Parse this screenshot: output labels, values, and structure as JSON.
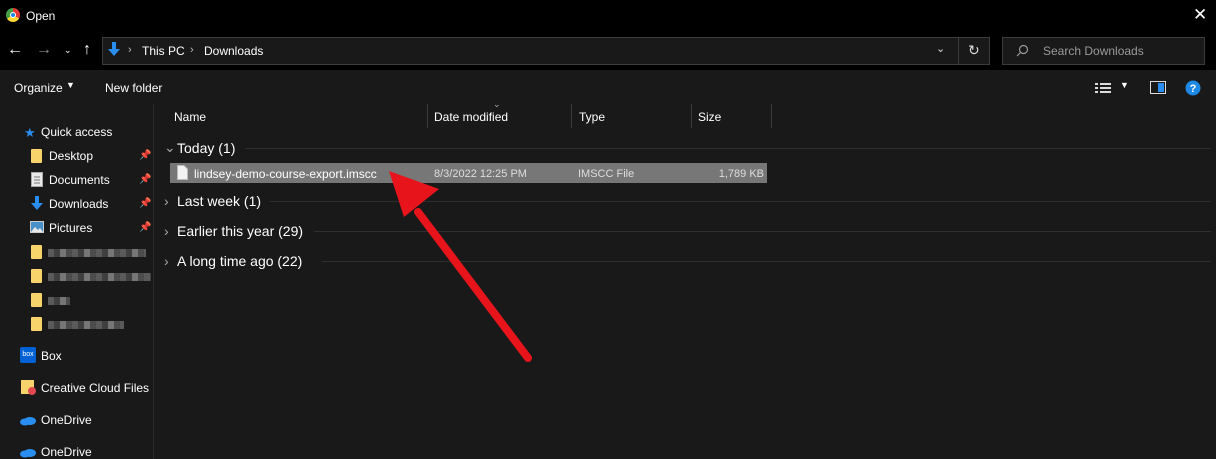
{
  "window": {
    "title": "Open"
  },
  "address": {
    "crumbs": [
      "This PC",
      "Downloads"
    ]
  },
  "search": {
    "placeholder": "Search Downloads"
  },
  "toolbar": {
    "organize": "Organize",
    "new_folder": "New folder"
  },
  "columns": {
    "name": "Name",
    "date": "Date modified",
    "type": "Type",
    "size": "Size"
  },
  "groups": {
    "today": "Today (1)",
    "last_week": "Last week (1)",
    "earlier": "Earlier this year (29)",
    "long_ago": "A long time ago (22)"
  },
  "file": {
    "name": "lindsey-demo-course-export.imscc",
    "date": "8/3/2022 12:25 PM",
    "type": "IMSCC File",
    "size": "1,789 KB"
  },
  "sidebar": {
    "quick_access": "Quick access",
    "desktop": "Desktop",
    "documents": "Documents",
    "downloads": "Downloads",
    "pictures": "Pictures",
    "box": "Box",
    "creative_cloud": "Creative Cloud Files",
    "onedrive1": "OneDrive",
    "onedrive2": "OneDrive",
    "box_icon_text": "box"
  },
  "colors": {
    "accent": "#0078d4",
    "arrow": "#e8141b",
    "selection": "#777777",
    "help": "#1e88e5"
  }
}
